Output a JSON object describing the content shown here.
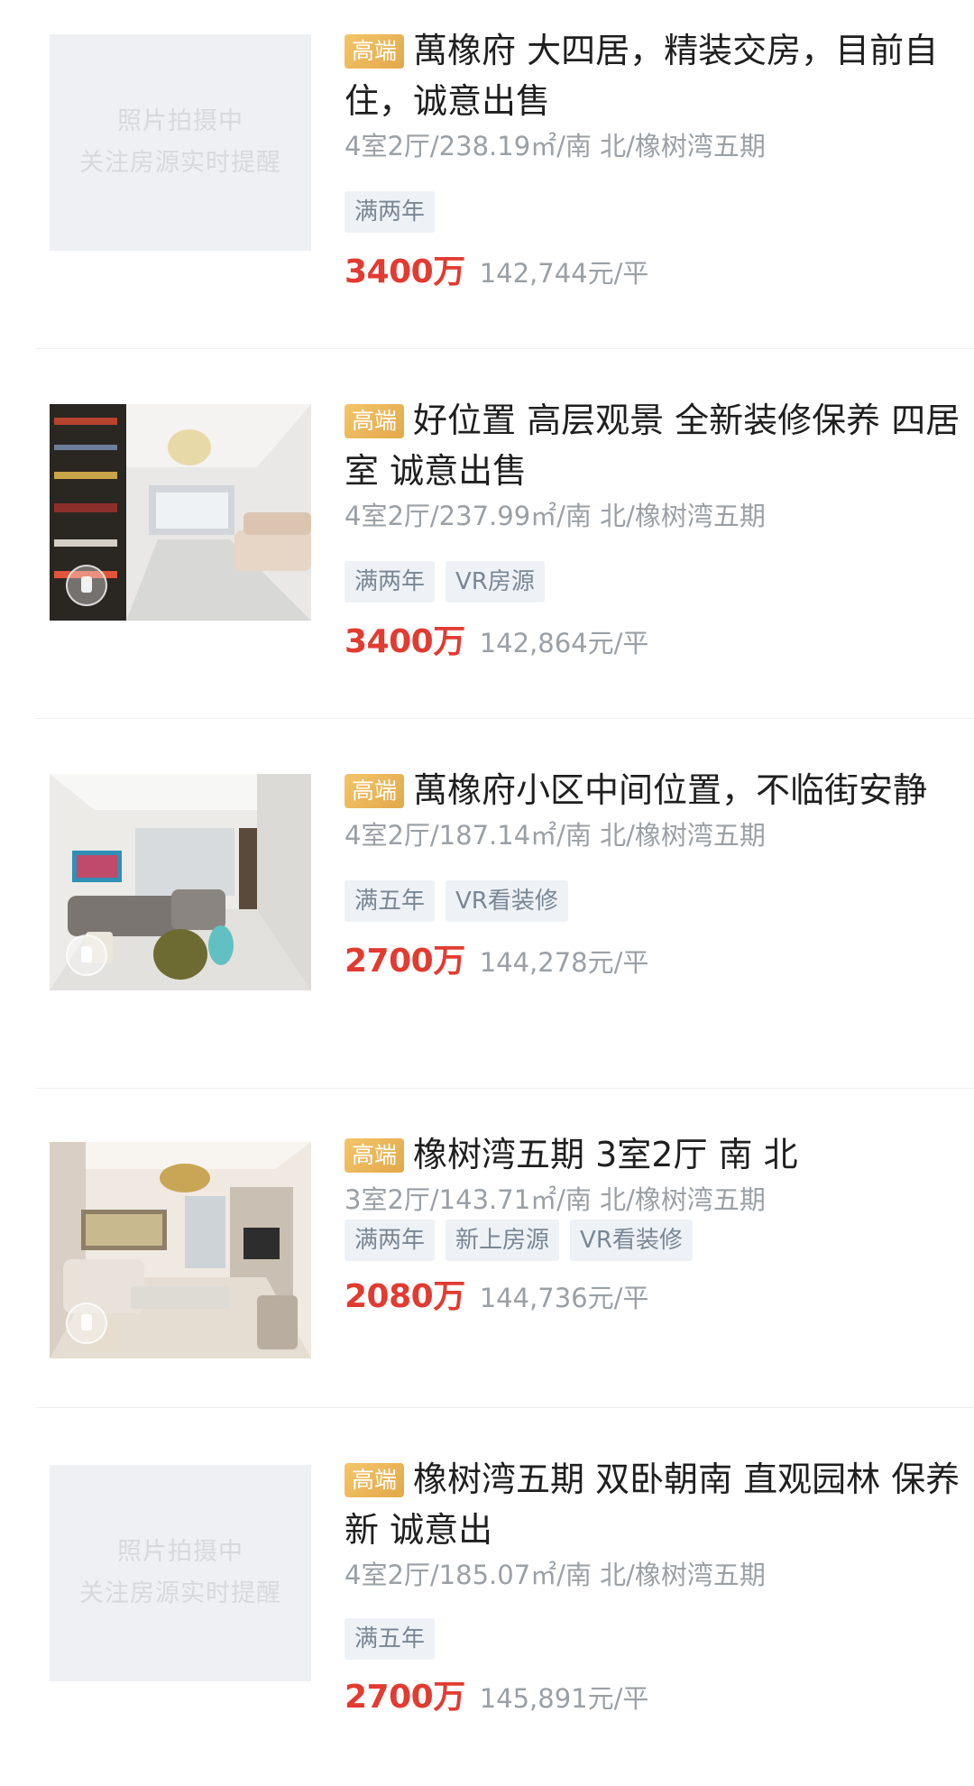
{
  "placeholder": {
    "line1": "照片拍摄中",
    "line2": "关注房源实时提醒"
  },
  "listings": [
    {
      "badge": "高端",
      "title": "萬橡府 大四居，精装交房，目前自住，诚意出售",
      "meta": "4室2厅/238.19㎡/南 北/橡树湾五期",
      "tags": [
        "满两年"
      ],
      "price": "3400万",
      "unit_price": "142,744元/平"
    },
    {
      "badge": "高端",
      "title": "好位置 高层观景 全新装修保养 四居室 诚意出售",
      "meta": "4室2厅/237.99㎡/南 北/橡树湾五期",
      "tags": [
        "满两年",
        "VR房源"
      ],
      "price": "3400万",
      "unit_price": "142,864元/平"
    },
    {
      "badge": "高端",
      "title": "萬橡府小区中间位置，不临街安静",
      "meta": "4室2厅/187.14㎡/南 北/橡树湾五期",
      "tags": [
        "满五年",
        "VR看装修"
      ],
      "price": "2700万",
      "unit_price": "144,278元/平"
    },
    {
      "badge": "高端",
      "title": "橡树湾五期 3室2厅 南 北",
      "meta": "3室2厅/143.71㎡/南 北/橡树湾五期",
      "tags": [
        "满两年",
        "新上房源",
        "VR看装修"
      ],
      "price": "2080万",
      "unit_price": "144,736元/平"
    },
    {
      "badge": "高端",
      "title": "橡树湾五期 双卧朝南 直观园林 保养新 诚意出",
      "meta": "4室2厅/185.07㎡/南 北/橡树湾五期",
      "tags": [
        "满五年"
      ],
      "price": "2700万",
      "unit_price": "145,891元/平"
    }
  ]
}
